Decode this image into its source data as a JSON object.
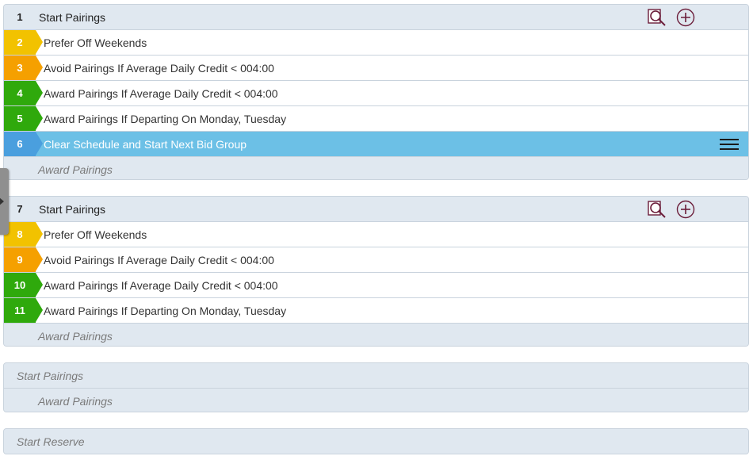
{
  "groups": [
    {
      "header": {
        "number": "1",
        "label": "Start Pairings"
      },
      "rules": [
        {
          "number": "2",
          "label": "Prefer Off Weekends",
          "color": "yellow"
        },
        {
          "number": "3",
          "label": "Avoid Pairings If Average Daily Credit < 004:00",
          "color": "orange"
        },
        {
          "number": "4",
          "label": "Award Pairings If Average Daily Credit < 004:00",
          "color": "green"
        },
        {
          "number": "5",
          "label": "Award Pairings If Departing On Monday, Tuesday",
          "color": "green"
        },
        {
          "number": "6",
          "label": "Clear Schedule and Start Next Bid Group",
          "color": "blue",
          "selected": true
        }
      ],
      "footer": "Award Pairings"
    },
    {
      "header": {
        "number": "7",
        "label": "Start Pairings"
      },
      "rules": [
        {
          "number": "8",
          "label": "Prefer Off Weekends",
          "color": "yellow"
        },
        {
          "number": "9",
          "label": "Avoid Pairings If Average Daily Credit < 004:00",
          "color": "orange"
        },
        {
          "number": "10",
          "label": "Award Pairings If Average Daily Credit < 004:00",
          "color": "green"
        },
        {
          "number": "11",
          "label": "Award Pairings If Departing On Monday, Tuesday",
          "color": "green"
        }
      ],
      "footer": "Award Pairings"
    },
    {
      "lines": [
        "Start Pairings",
        "Award Pairings"
      ]
    },
    {
      "lines": [
        "Start Reserve"
      ]
    }
  ],
  "icons": {
    "search": "search-icon",
    "add": "add-icon",
    "menu": "hamburger-menu-icon",
    "side_toggle": "expand-arrow-icon"
  },
  "colors": {
    "yellow": "#f2c200",
    "orange": "#f5a000",
    "green": "#2fa90c",
    "blue": "#4a9fde",
    "selected_row": "#6cc0e6",
    "panel": "#e0e8f0",
    "icon_maroon": "#6b1d3a"
  }
}
